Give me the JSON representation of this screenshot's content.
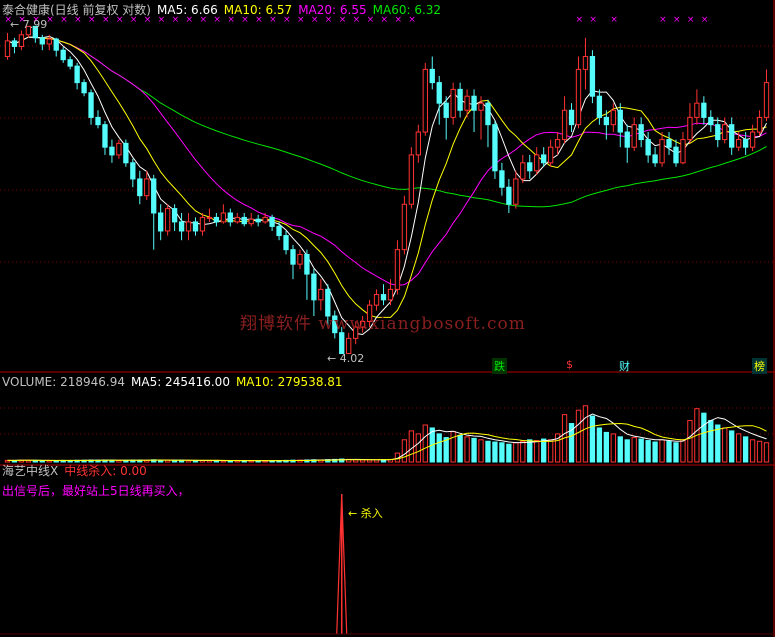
{
  "header": {
    "title": "泰合健康(日线 前复权 对数)",
    "ma5": "MA5: 6.66",
    "ma10": "MA10: 6.57",
    "ma20": "MA20: 6.55",
    "ma60": "MA60: 6.32"
  },
  "volume_header": {
    "volume": "VOLUME: 218946.94",
    "ma5": "MA5: 245416.00",
    "ma10": "MA10: 279538.81"
  },
  "indicator_header": {
    "name": "海艺中线X",
    "value": "中线杀入: 0.00",
    "hint": "出信号后，最好站上5日线再买入，"
  },
  "watermark": "翔博软件 www.xiangbosoft.com",
  "annotations": {
    "high_label": "7.99",
    "low_label": "4.02",
    "signal_label": "杀入"
  },
  "event_markers": [
    "跌",
    "$",
    "财",
    "榜"
  ],
  "colors": {
    "background": "#000000",
    "up": "#ff3232",
    "down": "#54fcfc",
    "ma5": "#ffffff",
    "ma10": "#ffff00",
    "ma20": "#ff00ff",
    "ma60": "#00e600",
    "grid": "#800000",
    "signal": "#ff3232"
  },
  "chart_data": {
    "type": "candlestick",
    "scale": "log",
    "ylim": [
      3.9,
      8.2
    ],
    "high": 7.99,
    "low": 4.02,
    "candles": [
      [
        7.5,
        7.75,
        7.88,
        7.45
      ],
      [
        7.75,
        7.66,
        7.8,
        7.55
      ],
      [
        7.66,
        7.85,
        7.92,
        7.6
      ],
      [
        7.85,
        7.99,
        7.99,
        7.8
      ],
      [
        7.99,
        7.8,
        7.99,
        7.72
      ],
      [
        7.8,
        7.7,
        7.85,
        7.6
      ],
      [
        7.7,
        7.78,
        7.85,
        7.6
      ],
      [
        7.78,
        7.6,
        7.8,
        7.5
      ],
      [
        7.6,
        7.45,
        7.65,
        7.4
      ],
      [
        7.45,
        7.35,
        7.5,
        7.3
      ],
      [
        7.35,
        7.1,
        7.4,
        7.0
      ],
      [
        7.1,
        6.95,
        7.15,
        6.9
      ],
      [
        6.95,
        6.6,
        7.0,
        6.5
      ],
      [
        6.6,
        6.5,
        6.7,
        6.45
      ],
      [
        6.5,
        6.2,
        6.55,
        6.1
      ],
      [
        6.2,
        6.1,
        6.3,
        6.0
      ],
      [
        6.1,
        6.25,
        6.3,
        6.05
      ],
      [
        6.25,
        6.0,
        6.3,
        5.95
      ],
      [
        6.0,
        5.8,
        6.05,
        5.7
      ],
      [
        5.8,
        5.6,
        5.9,
        5.5
      ],
      [
        5.6,
        5.8,
        5.9,
        5.55
      ],
      [
        5.8,
        5.4,
        5.85,
        5.0
      ],
      [
        5.4,
        5.2,
        5.5,
        5.1
      ],
      [
        5.2,
        5.45,
        5.5,
        5.15
      ],
      [
        5.45,
        5.3,
        5.5,
        5.2
      ],
      [
        5.3,
        5.2,
        5.4,
        5.1
      ],
      [
        5.2,
        5.3,
        5.4,
        5.1
      ],
      [
        5.3,
        5.2,
        5.35,
        5.15
      ],
      [
        5.2,
        5.35,
        5.4,
        5.15
      ],
      [
        5.35,
        5.35,
        5.45,
        5.3
      ],
      [
        5.35,
        5.3,
        5.4,
        5.25
      ],
      [
        5.3,
        5.4,
        5.5,
        5.28
      ],
      [
        5.4,
        5.3,
        5.45,
        5.25
      ],
      [
        5.3,
        5.35,
        5.4,
        5.28
      ],
      [
        5.35,
        5.28,
        5.4,
        5.25
      ],
      [
        5.28,
        5.33,
        5.4,
        5.25
      ],
      [
        5.33,
        5.3,
        5.38,
        5.25
      ],
      [
        5.3,
        5.35,
        5.4,
        5.28
      ],
      [
        5.35,
        5.25,
        5.38,
        5.2
      ],
      [
        5.25,
        5.15,
        5.3,
        5.1
      ],
      [
        5.15,
        5.0,
        5.2,
        4.95
      ],
      [
        5.0,
        4.85,
        5.05,
        4.7
      ],
      [
        4.85,
        4.95,
        5.0,
        4.8
      ],
      [
        4.95,
        4.75,
        5.0,
        4.5
      ],
      [
        4.75,
        4.5,
        4.8,
        4.35
      ],
      [
        4.5,
        4.6,
        4.7,
        4.4
      ],
      [
        4.6,
        4.35,
        4.65,
        4.25
      ],
      [
        4.35,
        4.2,
        4.4,
        4.15
      ],
      [
        4.2,
        4.02,
        4.25,
        4.02
      ],
      [
        4.02,
        4.15,
        4.2,
        4.02
      ],
      [
        4.15,
        4.25,
        4.3,
        4.1
      ],
      [
        4.25,
        4.3,
        4.35,
        4.2
      ],
      [
        4.3,
        4.45,
        4.5,
        4.25
      ],
      [
        4.45,
        4.55,
        4.6,
        4.4
      ],
      [
        4.55,
        4.5,
        4.65,
        4.45
      ],
      [
        4.5,
        4.6,
        4.7,
        4.45
      ],
      [
        4.6,
        5.0,
        5.1,
        4.55
      ],
      [
        5.0,
        5.5,
        5.6,
        4.95
      ],
      [
        5.5,
        6.1,
        6.2,
        5.45
      ],
      [
        6.1,
        6.4,
        6.5,
        6.0
      ],
      [
        6.4,
        7.3,
        7.4,
        6.35
      ],
      [
        7.3,
        7.1,
        7.5,
        7.0
      ],
      [
        7.1,
        6.8,
        7.2,
        6.5
      ],
      [
        6.8,
        6.6,
        6.9,
        6.3
      ],
      [
        6.6,
        7.0,
        7.1,
        6.5
      ],
      [
        7.0,
        6.7,
        7.1,
        6.6
      ],
      [
        6.7,
        6.9,
        7.0,
        6.6
      ],
      [
        6.9,
        6.7,
        7.0,
        6.4
      ],
      [
        6.7,
        6.8,
        6.9,
        6.3
      ],
      [
        6.8,
        6.5,
        6.85,
        6.2
      ],
      [
        6.5,
        5.9,
        6.55,
        5.8
      ],
      [
        5.9,
        5.7,
        6.0,
        5.6
      ],
      [
        5.7,
        5.5,
        5.8,
        5.4
      ],
      [
        5.5,
        5.8,
        5.9,
        5.45
      ],
      [
        5.8,
        6.0,
        6.1,
        5.75
      ],
      [
        6.0,
        5.9,
        6.1,
        5.8
      ],
      [
        5.9,
        6.1,
        6.2,
        5.85
      ],
      [
        6.1,
        6.0,
        6.2,
        5.95
      ],
      [
        6.0,
        6.2,
        6.3,
        5.95
      ],
      [
        6.2,
        6.3,
        6.4,
        6.1
      ],
      [
        6.3,
        6.7,
        6.9,
        6.25
      ],
      [
        6.7,
        6.5,
        6.8,
        6.4
      ],
      [
        6.5,
        7.3,
        7.5,
        6.45
      ],
      [
        7.3,
        7.5,
        7.8,
        7.0
      ],
      [
        7.5,
        6.9,
        7.6,
        6.8
      ],
      [
        6.9,
        6.6,
        7.0,
        6.5
      ],
      [
        6.6,
        6.5,
        6.7,
        6.3
      ],
      [
        6.5,
        6.7,
        6.8,
        6.4
      ],
      [
        6.7,
        6.4,
        6.8,
        6.2
      ],
      [
        6.4,
        6.2,
        6.5,
        6.0
      ],
      [
        6.2,
        6.5,
        6.6,
        6.15
      ],
      [
        6.5,
        6.3,
        6.6,
        6.2
      ],
      [
        6.3,
        6.1,
        6.4,
        6.0
      ],
      [
        6.1,
        6.0,
        6.2,
        5.95
      ],
      [
        6.0,
        6.3,
        6.4,
        5.95
      ],
      [
        6.3,
        6.2,
        6.4,
        6.1
      ],
      [
        6.2,
        6.0,
        6.3,
        5.95
      ],
      [
        6.0,
        6.3,
        6.4,
        5.98
      ],
      [
        6.3,
        6.6,
        6.8,
        6.25
      ],
      [
        6.6,
        6.8,
        7.0,
        6.5
      ],
      [
        6.8,
        6.6,
        6.9,
        6.5
      ],
      [
        6.6,
        6.5,
        6.7,
        6.4
      ],
      [
        6.5,
        6.3,
        6.6,
        6.2
      ],
      [
        6.3,
        6.5,
        6.6,
        6.25
      ],
      [
        6.5,
        6.2,
        6.6,
        6.1
      ],
      [
        6.2,
        6.3,
        6.4,
        6.15
      ],
      [
        6.3,
        6.2,
        6.4,
        6.1
      ],
      [
        6.2,
        6.4,
        6.5,
        6.15
      ],
      [
        6.4,
        6.6,
        6.7,
        6.35
      ],
      [
        6.6,
        7.1,
        7.3,
        6.55
      ]
    ],
    "volume": {
      "ylim": [
        0,
        1000000
      ],
      "values": [
        22000,
        20000,
        25000,
        24000,
        21000,
        19000,
        18000,
        20000,
        22000,
        21000,
        23000,
        24000,
        26000,
        25000,
        27000,
        24000,
        22000,
        23000,
        26000,
        25000,
        24000,
        30000,
        27000,
        25000,
        22000,
        21000,
        20000,
        19000,
        21000,
        20000,
        18000,
        19000,
        20000,
        18000,
        19000,
        18000,
        17000,
        18000,
        19000,
        20000,
        22000,
        25000,
        24000,
        27000,
        30000,
        28000,
        32000,
        35000,
        40000,
        36000,
        30000,
        28000,
        27000,
        30000,
        32000,
        35000,
        120000,
        300000,
        420000,
        380000,
        500000,
        460000,
        380000,
        330000,
        410000,
        360000,
        340000,
        320000,
        300000,
        280000,
        270000,
        260000,
        240000,
        260000,
        280000,
        300000,
        290000,
        310000,
        300000,
        380000,
        640000,
        520000,
        700000,
        760000,
        620000,
        460000,
        400000,
        380000,
        340000,
        300000,
        330000,
        310000,
        290000,
        270000,
        300000,
        280000,
        260000,
        300000,
        560000,
        720000,
        660000,
        560000,
        500000,
        460000,
        420000,
        380000,
        340000,
        300000,
        280000,
        260000
      ],
      "last": 218946.94,
      "ma5": 245416.0,
      "ma10": 279538.81
    },
    "indicator": {
      "name": "中线杀入",
      "value": 0.0,
      "signal_index": 48,
      "ylim": [
        0,
        1
      ]
    }
  }
}
